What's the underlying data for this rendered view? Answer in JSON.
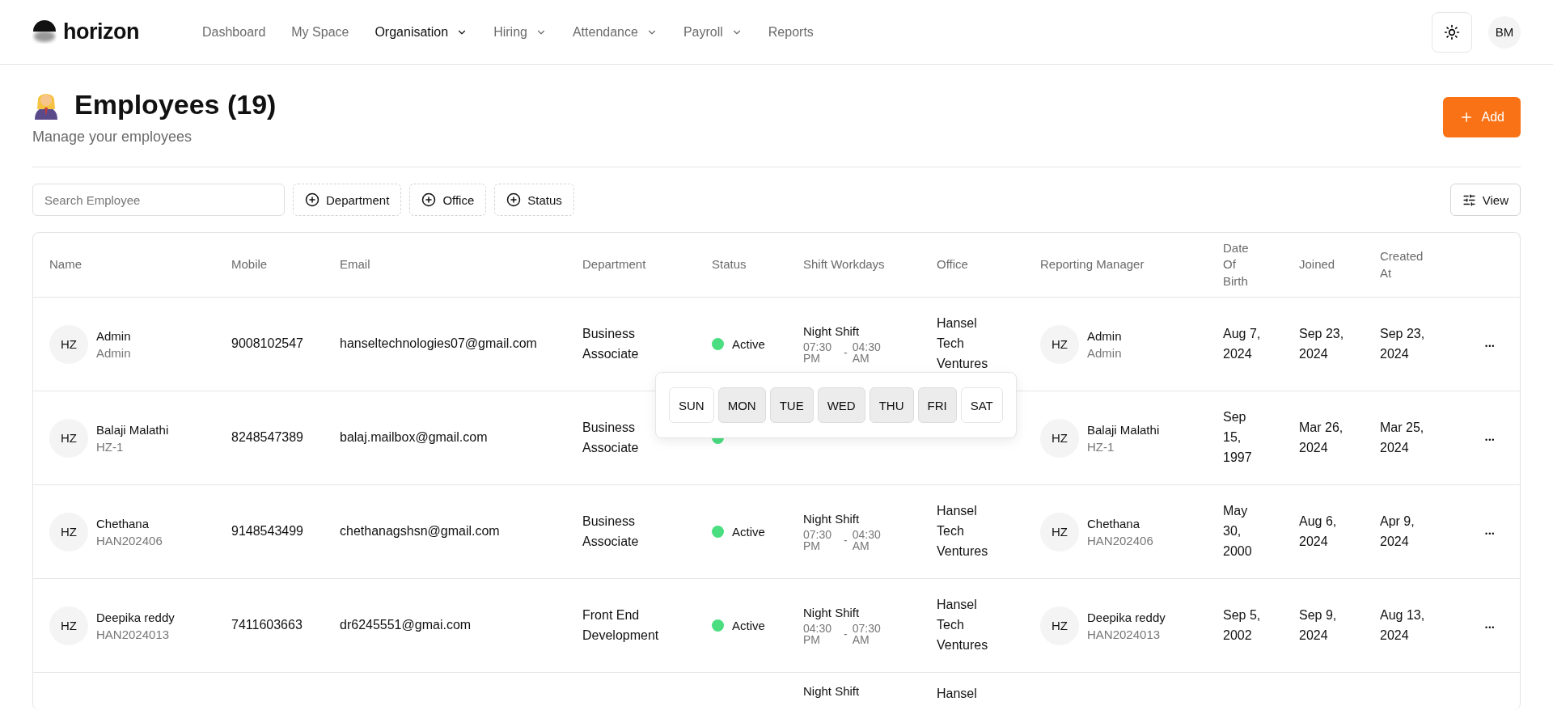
{
  "brand": {
    "name": "horizon"
  },
  "nav": [
    {
      "label": "Dashboard",
      "selected": false,
      "dropdown": false
    },
    {
      "label": "My Space",
      "selected": false,
      "dropdown": false
    },
    {
      "label": "Organisation",
      "selected": true,
      "dropdown": true
    },
    {
      "label": "Hiring",
      "selected": false,
      "dropdown": true
    },
    {
      "label": "Attendance",
      "selected": false,
      "dropdown": true
    },
    {
      "label": "Payroll",
      "selected": false,
      "dropdown": true
    },
    {
      "label": "Reports",
      "selected": false,
      "dropdown": false
    }
  ],
  "user": {
    "initials": "BM"
  },
  "page": {
    "title": "Employees (19)",
    "subtitle": "Manage your employees",
    "add_button": "Add"
  },
  "toolbar": {
    "search": {
      "placeholder": "Search Employee"
    },
    "filters": [
      "Department",
      "Office",
      "Status"
    ],
    "view_button": "View"
  },
  "table": {
    "columns": [
      "Name",
      "Mobile",
      "Email",
      "Department",
      "Status",
      "Shift Workdays",
      "Office",
      "Reporting Manager",
      "Date Of Birth",
      "Joined",
      "Created At"
    ],
    "rows": [
      {
        "avatar": "HZ",
        "name": "Admin",
        "code": "Admin",
        "mobile": "9008102547",
        "email": "hanseltechnologies07@gmail.com",
        "department": "Business Associate",
        "status": {
          "label": "Active",
          "color": "#4ade80"
        },
        "shift": {
          "name": "Night Shift",
          "start": "07:30 PM",
          "separator": "-",
          "end": "04:30 AM"
        },
        "office": "Hansel Tech Ventures",
        "manager": {
          "avatar": "HZ",
          "name": "Admin",
          "code": "Admin"
        },
        "dob": "Aug 7, 2024",
        "joined": "Sep 23, 2024",
        "created": "Sep 23, 2024",
        "more": "•••"
      },
      {
        "avatar": "HZ",
        "name": "Balaji Malathi",
        "code": "HZ-1",
        "mobile": "8248547389",
        "email": "balaj.mailbox@gmail.com",
        "department": "Business Associate",
        "status": {
          "color": "#4ade80"
        },
        "manager": {
          "avatar": "HZ",
          "name": "Balaji Malathi",
          "code": "HZ-1"
        },
        "dob": "Sep 15, 1997",
        "joined": "Mar 26, 2024",
        "created": "Mar 25, 2024",
        "more": "•••"
      },
      {
        "avatar": "HZ",
        "name": "Chethana",
        "code": "HAN202406",
        "mobile": "9148543499",
        "email": "chethanagshsn@gmail.com",
        "department": "Business Associate",
        "status": {
          "label": "Active",
          "color": "#4ade80"
        },
        "shift": {
          "name": "Night Shift",
          "start": "07:30 PM",
          "separator": "-",
          "end": "04:30 AM"
        },
        "office": "Hansel Tech Ventures",
        "manager": {
          "avatar": "HZ",
          "name": "Chethana",
          "code": "HAN202406"
        },
        "dob": "May 30, 2000",
        "joined": "Aug 6, 2024",
        "created": "Apr 9, 2024",
        "more": "•••"
      },
      {
        "avatar": "HZ",
        "name": "Deepika reddy",
        "code": "HAN2024013",
        "mobile": "7411603663",
        "email": "dr6245551@gmai.com",
        "department": "Front End Development",
        "status": {
          "label": "Active",
          "color": "#4ade80"
        },
        "shift": {
          "name": "Night Shift",
          "start": "04:30 PM",
          "separator": "-",
          "end": "07:30 AM"
        },
        "office": "Hansel Tech Ventures",
        "manager": {
          "avatar": "HZ",
          "name": "Deepika reddy",
          "code": "HAN2024013"
        },
        "dob": "Sep 5, 2002",
        "joined": "Sep 9, 2024",
        "created": "Aug 13, 2024",
        "more": "•••"
      },
      {
        "shift": {
          "name": "Night Shift"
        },
        "office": "Hansel"
      }
    ]
  },
  "workdays_popup": {
    "days": [
      {
        "label": "SUN",
        "selected": false
      },
      {
        "label": "MON",
        "selected": true
      },
      {
        "label": "TUE",
        "selected": true
      },
      {
        "label": "WED",
        "selected": true
      },
      {
        "label": "THU",
        "selected": true
      },
      {
        "label": "FRI",
        "selected": true
      },
      {
        "label": "SAT",
        "selected": false
      }
    ]
  }
}
